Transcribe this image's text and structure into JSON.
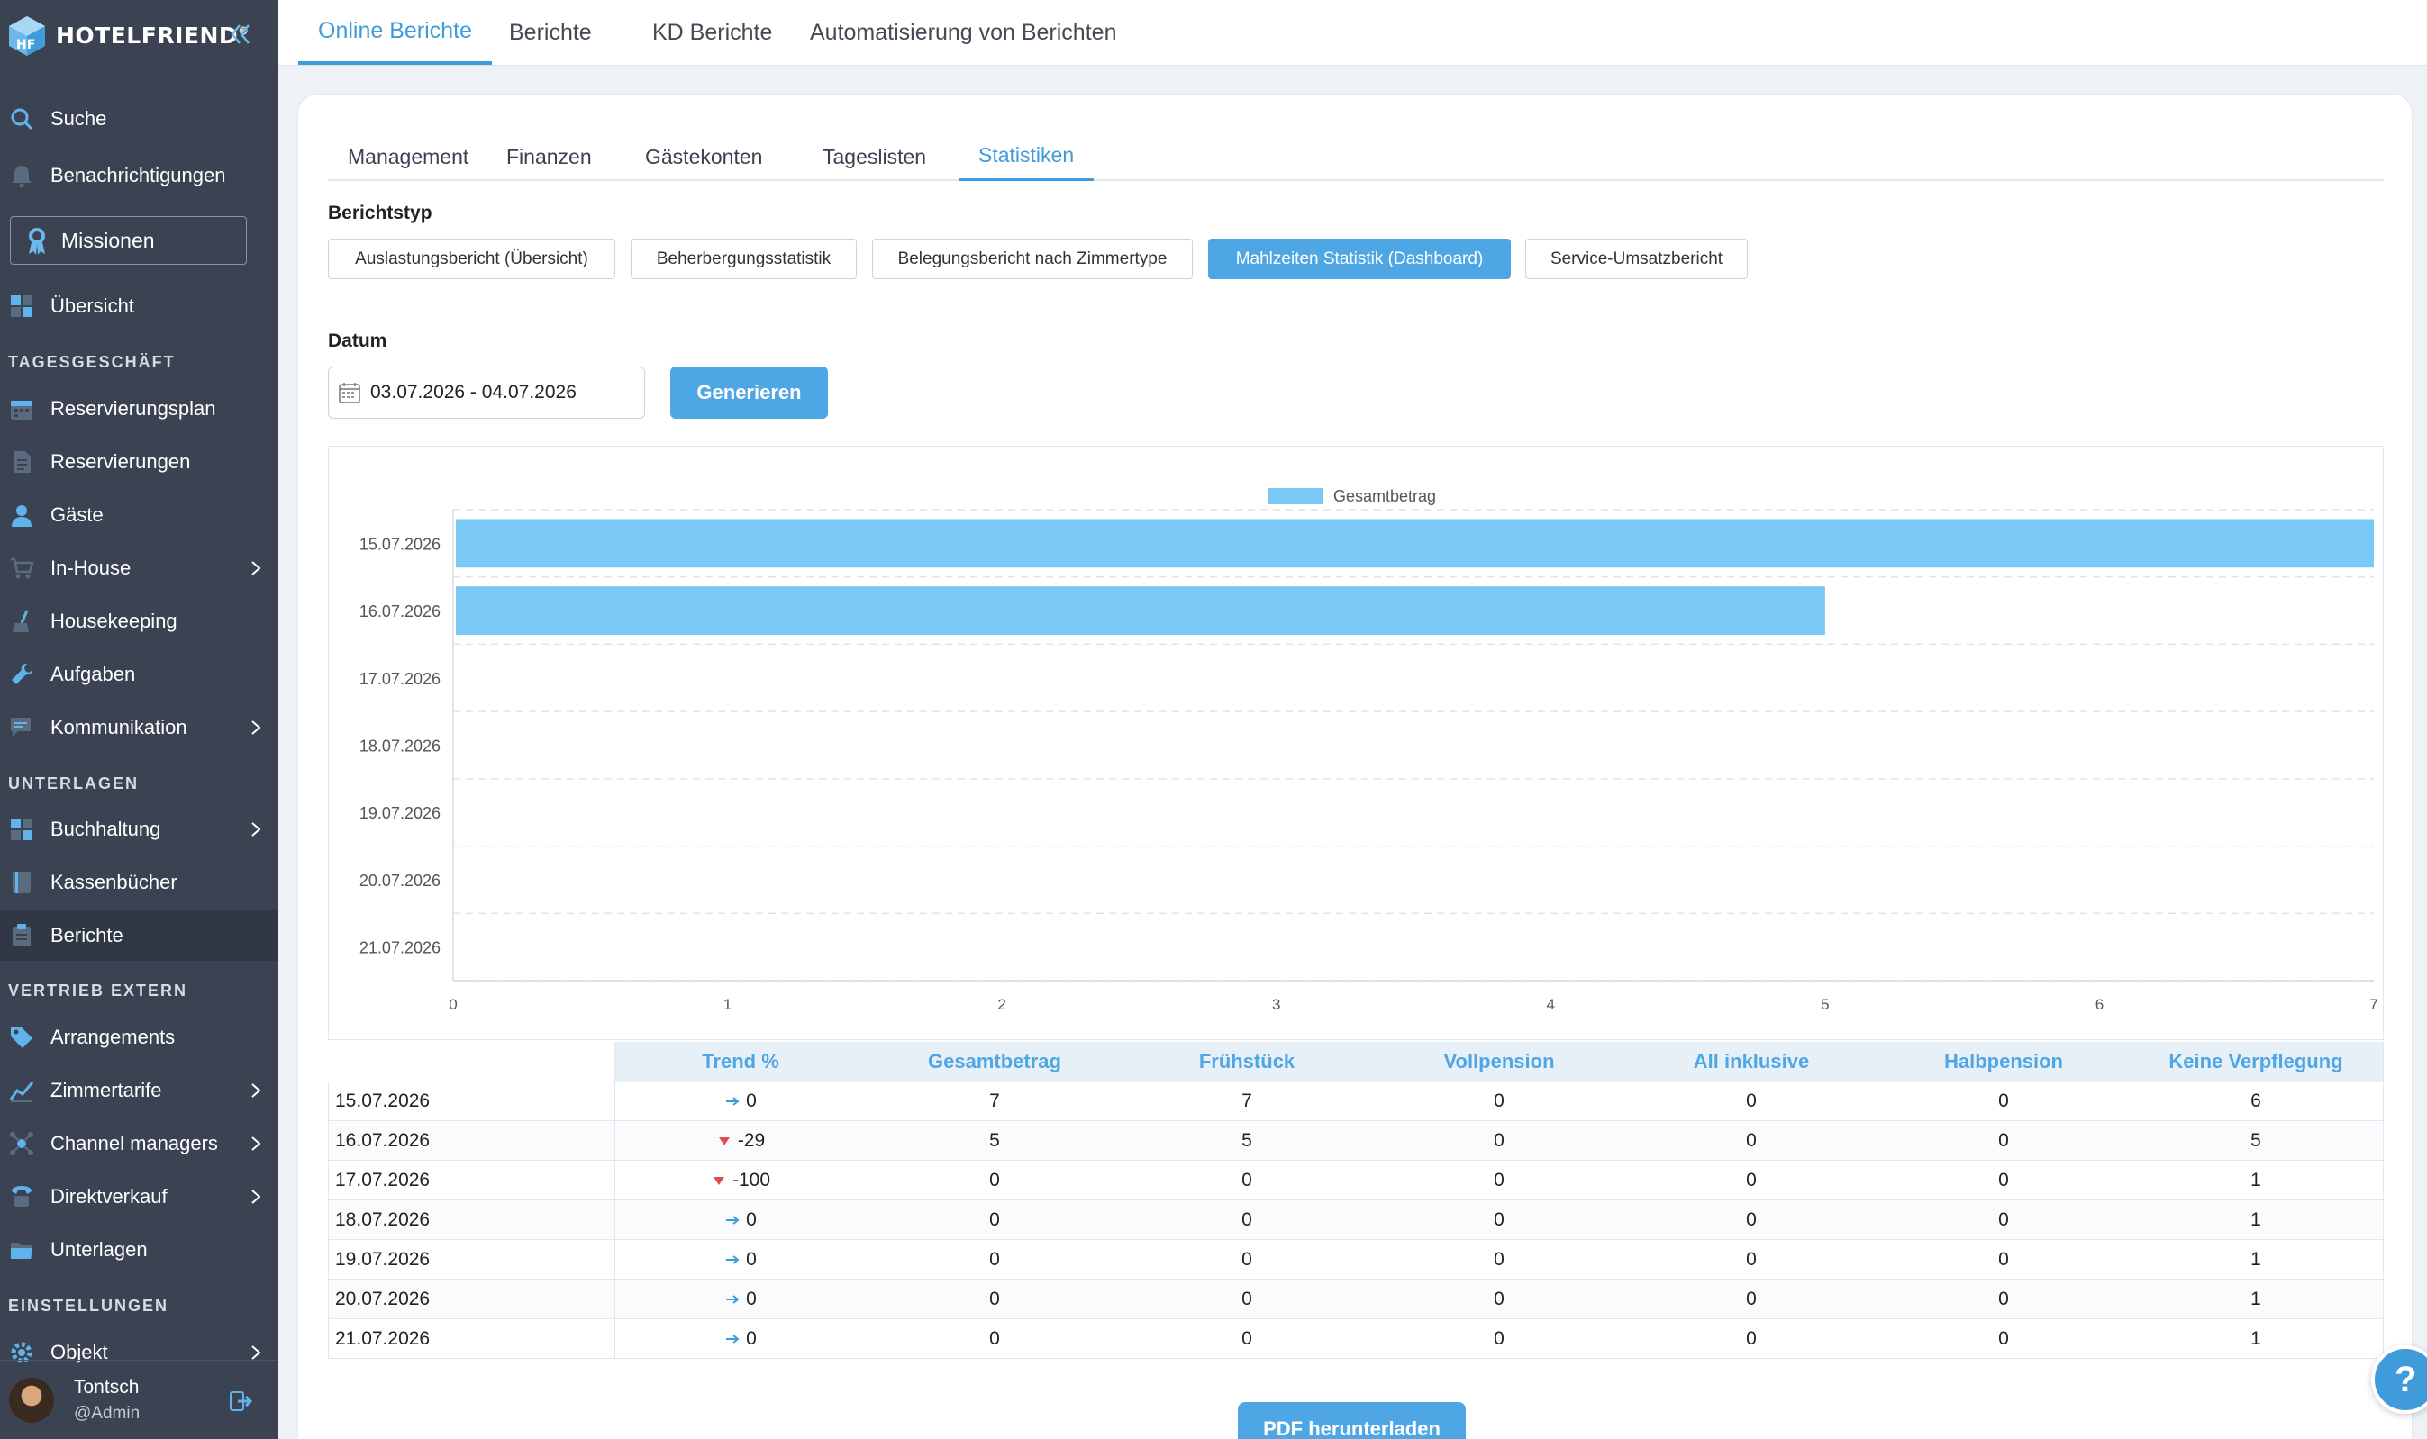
{
  "sidebar": {
    "brand": "HOTELFRIEND",
    "brand_mark": "®",
    "search": "Suche",
    "notifications": "Benachrichtigungen",
    "missions": "Missionen",
    "overview": "Übersicht",
    "sections": {
      "daily": "TAGESGESCHÄFT",
      "docs": "UNTERLAGEN",
      "sales": "VERTRIEB EXTERN",
      "settings": "EINSTELLUNGEN"
    },
    "items": {
      "reservation_plan": "Reservierungsplan",
      "reservations": "Reservierungen",
      "guests": "Gäste",
      "in_house": "In-House",
      "housekeeping": "Housekeeping",
      "tasks": "Aufgaben",
      "communication": "Kommunikation",
      "accounting": "Buchhaltung",
      "cashbooks": "Kassenbücher",
      "reports": "Berichte",
      "arrangements": "Arrangements",
      "room_rates": "Zimmertarife",
      "channel_managers": "Channel managers",
      "direct_sales": "Direktverkauf",
      "documents": "Unterlagen",
      "object": "Objekt"
    },
    "user": {
      "name": "Tontsch",
      "role": "@Admin"
    }
  },
  "top_tabs": [
    "Online Berichte",
    "Berichte",
    "KD Berichte",
    "Automatisierung von Berichten"
  ],
  "sub_tabs": [
    "Management",
    "Finanzen",
    "Gästekonten",
    "Tageslisten",
    "Statistiken"
  ],
  "report_type_label": "Berichtstyp",
  "report_types": [
    "Auslastungsbericht (Übersicht)",
    "Beherbergungsstatistik",
    "Belegungsbericht nach Zimmertype",
    "Mahlzeiten Statistik (Dashboard)",
    "Service-Umsatzbericht"
  ],
  "date_label": "Datum",
  "date_range": "03.07.2026 - 04.07.2026",
  "generate_label": "Generieren",
  "pdf_label": "PDF herunterladen",
  "help_label": "?",
  "colors": {
    "accent": "#4ea7e4",
    "bar": "#79c8f5",
    "sidebar": "#3b4352",
    "trend_down": "#e04b4b",
    "trend_flat": "#3f9bd9"
  },
  "chart_data": {
    "type": "bar",
    "orientation": "horizontal",
    "categories": [
      "15.07.2026",
      "16.07.2026",
      "17.07.2026",
      "18.07.2026",
      "19.07.2026",
      "20.07.2026",
      "21.07.2026"
    ],
    "series": [
      {
        "name": "Gesamtbetrag",
        "values": [
          7,
          5,
          0,
          0,
          0,
          0,
          0
        ]
      }
    ],
    "xlim": [
      0,
      7
    ],
    "x_ticks": [
      0,
      1,
      2,
      3,
      4,
      5,
      6,
      7
    ],
    "legend": "top-center",
    "grid": true
  },
  "table": {
    "headers": [
      "Trend %",
      "Gesamtbetrag",
      "Frühstück",
      "Vollpension",
      "All inklusive",
      "Halbpension",
      "Keine Verpflegung"
    ],
    "rows": [
      {
        "date": "15.07.2026",
        "trend_dir": "flat",
        "trend": "0",
        "values": [
          "7",
          "7",
          "0",
          "0",
          "0",
          "6"
        ]
      },
      {
        "date": "16.07.2026",
        "trend_dir": "down",
        "trend": "-29",
        "values": [
          "5",
          "5",
          "0",
          "0",
          "0",
          "5"
        ]
      },
      {
        "date": "17.07.2026",
        "trend_dir": "down",
        "trend": "-100",
        "values": [
          "0",
          "0",
          "0",
          "0",
          "0",
          "1"
        ]
      },
      {
        "date": "18.07.2026",
        "trend_dir": "flat",
        "trend": "0",
        "values": [
          "0",
          "0",
          "0",
          "0",
          "0",
          "1"
        ]
      },
      {
        "date": "19.07.2026",
        "trend_dir": "flat",
        "trend": "0",
        "values": [
          "0",
          "0",
          "0",
          "0",
          "0",
          "1"
        ]
      },
      {
        "date": "20.07.2026",
        "trend_dir": "flat",
        "trend": "0",
        "values": [
          "0",
          "0",
          "0",
          "0",
          "0",
          "1"
        ]
      },
      {
        "date": "21.07.2026",
        "trend_dir": "flat",
        "trend": "0",
        "values": [
          "0",
          "0",
          "0",
          "0",
          "0",
          "1"
        ]
      }
    ]
  }
}
